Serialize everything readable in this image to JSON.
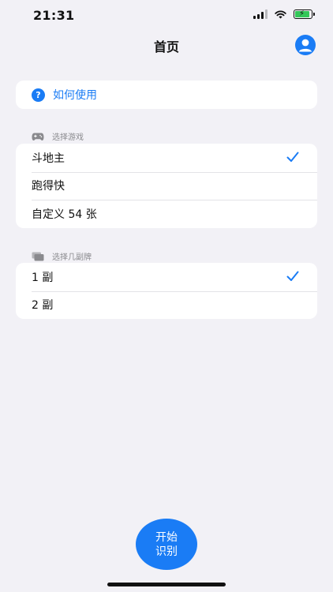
{
  "status_bar": {
    "time": "21:31"
  },
  "nav": {
    "title": "首页",
    "profile_icon": "person-circle-icon"
  },
  "help": {
    "label": "如何使用",
    "icon_glyph": "?"
  },
  "game_section": {
    "header": "选择游戏",
    "icon": "gamecontroller-icon",
    "options": [
      {
        "label": "斗地主",
        "selected": true
      },
      {
        "label": "跑得快",
        "selected": false
      },
      {
        "label": "自定义 54 张",
        "selected": false
      }
    ]
  },
  "deck_section": {
    "header": "选择几副牌",
    "icon": "cards-stack-icon",
    "options": [
      {
        "label": "1 副",
        "selected": true
      },
      {
        "label": "2 副",
        "selected": false
      }
    ]
  },
  "start_button": {
    "line1": "开始",
    "line2": "识别"
  },
  "colors": {
    "accent": "#1a7cf5",
    "background": "#f2f1f6",
    "battery": "#34c759"
  }
}
